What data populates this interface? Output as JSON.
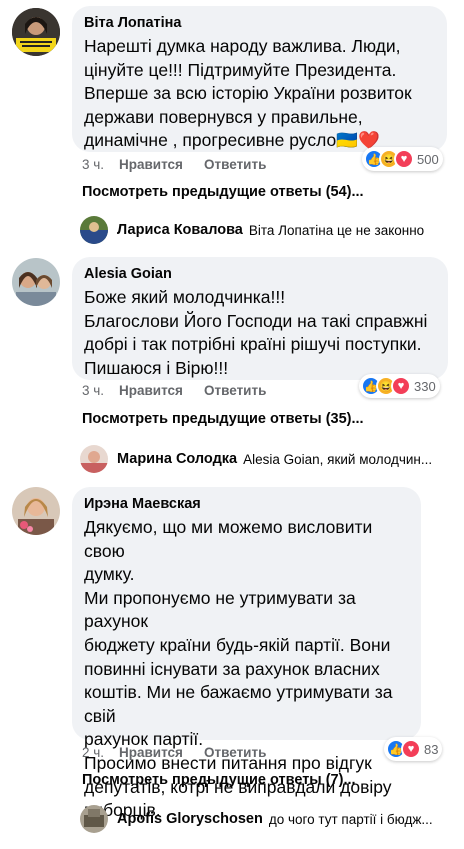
{
  "comments": [
    {
      "author": "Віта Лопатіна",
      "text": "Нарешті думка народу важлива. Люди,\nцінуйте це!!! Підтримуйте Президента.\nВперше за всю історію України розвиток\nдержави повернувся у правильне,\nдинамічне , прогресивне русло",
      "emoji": "🇺🇦❤️",
      "time": "3 ч.",
      "like_label": "Нравится",
      "reply_label": "Ответить",
      "reaction_count": "500",
      "reactions": [
        "like",
        "haha",
        "love"
      ],
      "previous_replies": "Посмотреть предыдущие ответы (54)...",
      "latest_reply": {
        "name": "Лариса Ковалова",
        "text": "Віта Лопатіна це не законно"
      }
    },
    {
      "author": "Alesia Goian",
      "text": "Боже який молодчинка!!!\nБлагослови Його Господи на такі справжні\nдобрі і так потрібні країні рішучі поступки.\nПишаюся і Вірю!!!",
      "emoji": "",
      "time": "3 ч.",
      "like_label": "Нравится",
      "reply_label": "Ответить",
      "reaction_count": "330",
      "reactions": [
        "like",
        "haha",
        "love"
      ],
      "previous_replies": "Посмотреть предыдущие ответы (35)...",
      "latest_reply": {
        "name": "Марина Солодка",
        "text": "Alesia Goian, який молодчин..."
      }
    },
    {
      "author": "Ирэна Маевская",
      "text": "Дякуємо, що ми можемо висловити свою\nдумку.\nМи пропонуємо не утримувати за рахунок\nбюджету країни будь-якій партії. Вони\nповинні існувати за рахунок власних\nкоштів. Ми не бажаємо утримувати за свій\nрахунок  партії.\nПросимо внести питання про відгук\nдепутатів, котрі не виправдали довіру\nвиборців.",
      "emoji": "",
      "time": "2 ч.",
      "like_label": "Нравится",
      "reply_label": "Ответить",
      "reaction_count": "83",
      "reactions": [
        "like",
        "love"
      ],
      "previous_replies": "Посмотреть предыдущие ответы (7)...",
      "latest_reply": {
        "name": "Apofis Gloryschosen",
        "text": "до чого тут партії і бюдж..."
      }
    }
  ],
  "colors": {
    "bubble": "#f0f2f5",
    "secondary_text": "#65676b",
    "like_blue": "#1877f2",
    "haha_yellow": "#f7b125",
    "love_red": "#f33e58"
  }
}
